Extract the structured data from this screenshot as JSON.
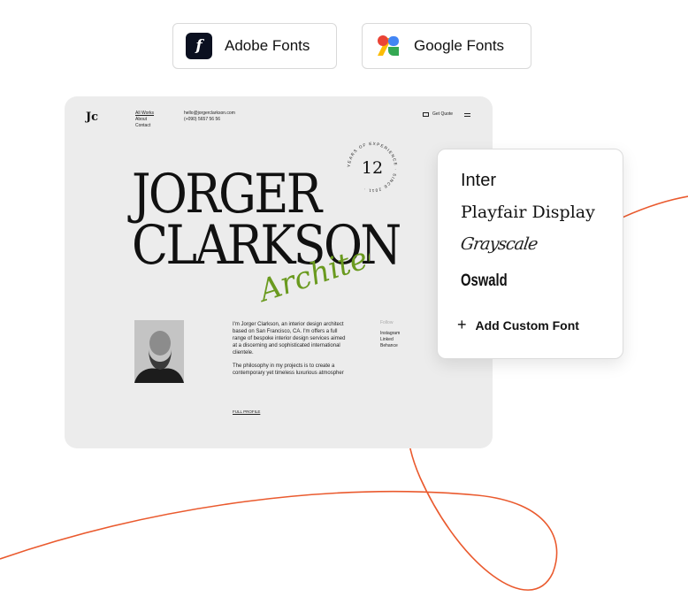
{
  "providers": {
    "adobe": {
      "label": "Adobe Fonts",
      "icon": "adobe-fonts-logo",
      "glyph": "f"
    },
    "google": {
      "label": "Google Fonts",
      "icon": "google-fonts-logo",
      "colors": [
        "#ea4335",
        "#fbbc04",
        "#4285f4",
        "#34a853"
      ]
    }
  },
  "preview": {
    "logo": "Jc",
    "nav": [
      "All Works",
      "About",
      "Contact"
    ],
    "contact": [
      "hello@jorgerclarkson.com",
      "(+090) 5657 56 56"
    ],
    "quote_label": "Get Quote",
    "badge": {
      "number": "12",
      "ring_text": "YEARS OF EXPERIENCE · SINCE 2011 ·"
    },
    "name_lines": [
      "JORGER",
      "CLARKSON"
    ],
    "script_word": "Architect",
    "bio": [
      "I'm Jorger Clarkson, an interior design architect based on San Francisco, CA. I'm offers a full range of bespoke interior design services aimed at a discerning and sophisticated international clientele.",
      "The philosophy in my projects is to create a contemporary yet timeless luxurious atmospher"
    ],
    "social_title": "Follow",
    "social": [
      "Instagram",
      "Linked",
      "Behance"
    ],
    "full_profile": "FULL PROFILE"
  },
  "font_panel": {
    "options": [
      "Inter",
      "Playfair Display",
      "Grayscale",
      "Oswald"
    ],
    "add_label": "Add Custom Font"
  },
  "colors": {
    "accent_curve": "#ea5a2e",
    "script_green": "#6a9a1f"
  }
}
